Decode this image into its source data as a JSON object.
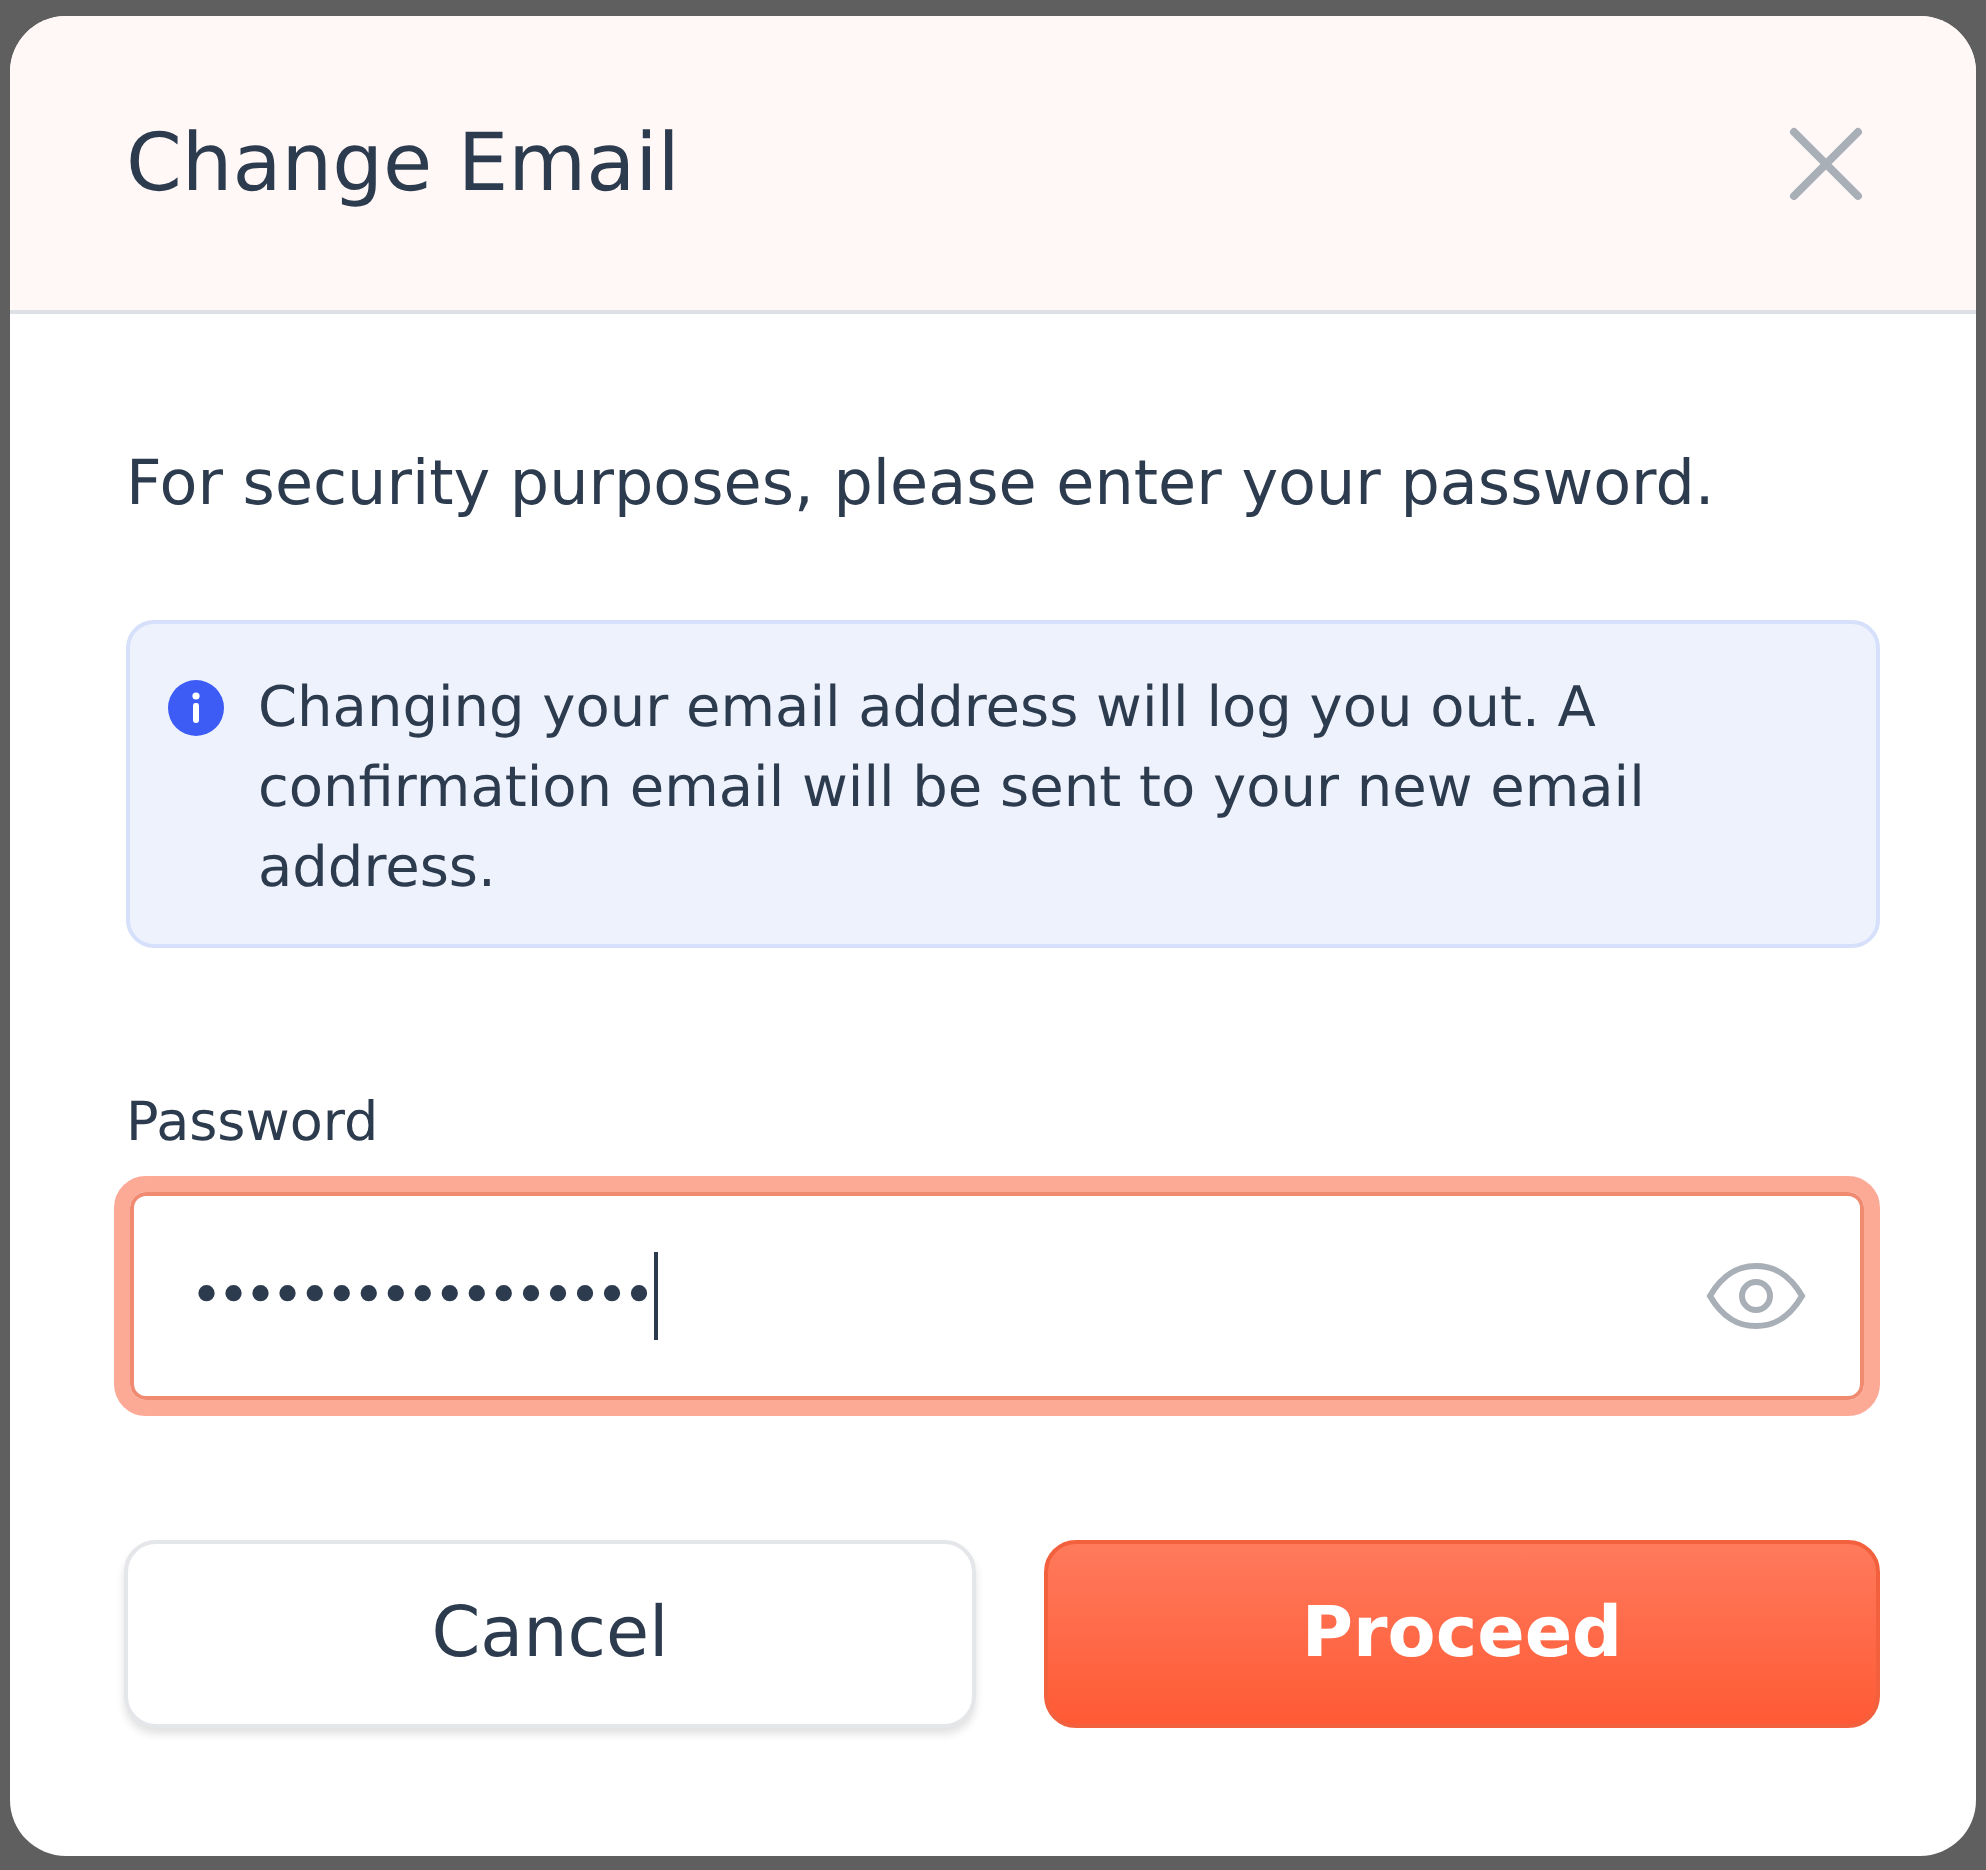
{
  "dialog": {
    "title": "Change Email"
  },
  "instructions": "For security purposes, please enter your password.",
  "notice": {
    "text": "Changing your email address will log you out. A confirmation email will be sent to your new email address."
  },
  "password_field": {
    "label": "Password",
    "value": "•••••••••••••••••",
    "focused": true
  },
  "buttons": [
    {
      "label": "Cancel",
      "kind": "secondary"
    },
    {
      "label": "Proceed",
      "kind": "primary"
    }
  ]
}
